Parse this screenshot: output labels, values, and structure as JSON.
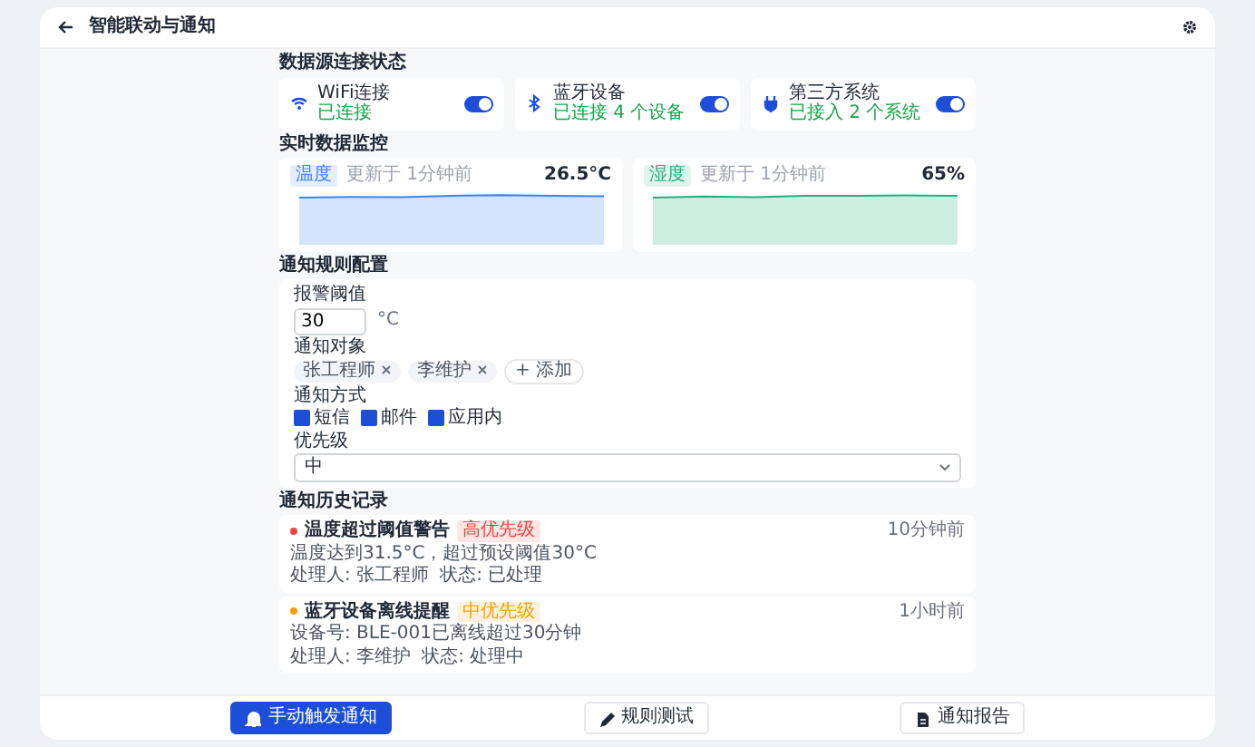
{
  "header": {
    "title": "智能联动与通知"
  },
  "sources": {
    "title": "数据源连接状态",
    "items": [
      {
        "name": "WiFi连接",
        "status": "已连接",
        "on": true
      },
      {
        "name": "蓝牙设备",
        "status": "已连接 4 个设备",
        "on": true
      },
      {
        "name": "第三方系统",
        "status": "已接入 2 个系统",
        "on": true
      }
    ]
  },
  "monitor": {
    "title": "实时数据监控",
    "charts": [
      {
        "tag": "温度",
        "updated": "更新于 1分钟前",
        "value": "26.5°C",
        "color": "#3b82f6"
      },
      {
        "tag": "湿度",
        "updated": "更新于 1分钟前",
        "value": "65%",
        "color": "#22b07d"
      }
    ]
  },
  "rules": {
    "title": "通知规则配置",
    "threshold": {
      "label": "报警阈值",
      "value": "30",
      "unit": "°C"
    },
    "recipients": {
      "label": "通知对象",
      "items": [
        "张工程师",
        "李维护"
      ],
      "add": "+ 添加"
    },
    "methods": {
      "label": "通知方式",
      "items": [
        {
          "label": "短信",
          "checked": true
        },
        {
          "label": "邮件",
          "checked": true
        },
        {
          "label": "应用内",
          "checked": true
        }
      ]
    },
    "priority": {
      "label": "优先级",
      "value": "中"
    }
  },
  "history": {
    "title": "通知历史记录",
    "items": [
      {
        "title": "温度超过阈值警告",
        "tag": "高优先级",
        "color": "#ef4444",
        "time": "10分钟前",
        "detail": "温度达到31.5°C，超过预设阈值30°C",
        "handler": "处理人: 张工程师",
        "state": "状态: 已处理"
      },
      {
        "title": "蓝牙设备离线提醒",
        "tag": "中优先级",
        "color": "#f59e0b",
        "time": "1小时前",
        "detail": "设备号: BLE-001已离线超过30分钟",
        "handler": "处理人: 李维护",
        "state": "状态: 处理中"
      }
    ]
  },
  "footer": {
    "buttons": [
      {
        "label": "手动触发通知",
        "primary": true
      },
      {
        "label": "规则测试",
        "primary": false
      },
      {
        "label": "通知报告",
        "primary": false
      }
    ]
  }
}
